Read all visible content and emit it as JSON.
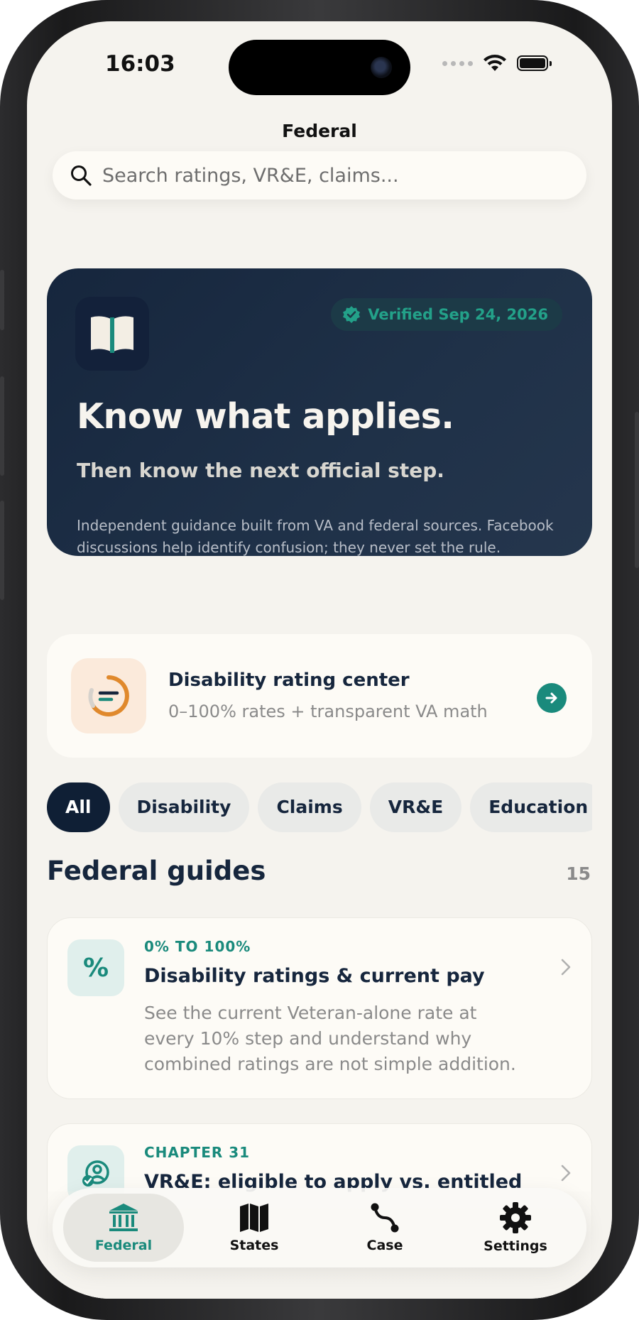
{
  "status": {
    "time": "16:03"
  },
  "header": {
    "title": "Federal"
  },
  "search": {
    "placeholder": "Search ratings, VR&E, claims..."
  },
  "hero": {
    "verified": "Verified Sep 24, 2026",
    "headline": "Know what applies.",
    "subheadline": "Then know the next official step.",
    "body": "Independent guidance built from VA and federal sources. Facebook discussions help identify confusion; they never set the rule."
  },
  "rating_center": {
    "title": "Disability rating center",
    "subtitle": "0–100% rates + transparent VA math"
  },
  "filters": [
    "All",
    "Disability",
    "Claims",
    "VR&E",
    "Education"
  ],
  "section": {
    "title": "Federal guides",
    "count": "15"
  },
  "guides": [
    {
      "tag": "0% TO 100%",
      "title": "Disability ratings & current pay",
      "description": "See the current Veteran-alone rate at every 10% step and understand why combined ratings are not simple addition.",
      "icon": "percent-icon"
    },
    {
      "tag": "CHAPTER 31",
      "title": "VR&E: eligible to apply vs. entitled",
      "description": "",
      "icon": "person-check-icon"
    }
  ],
  "tabs": [
    {
      "label": "Federal",
      "icon": "bank-icon",
      "active": true
    },
    {
      "label": "States",
      "icon": "map-icon",
      "active": false
    },
    {
      "label": "Case",
      "icon": "route-icon",
      "active": false
    },
    {
      "label": "Settings",
      "icon": "gear-icon",
      "active": false
    }
  ],
  "colors": {
    "accent": "#1a8a7c",
    "navy": "#16263d",
    "background": "#f5f3ee",
    "orange": "#e0892c"
  }
}
